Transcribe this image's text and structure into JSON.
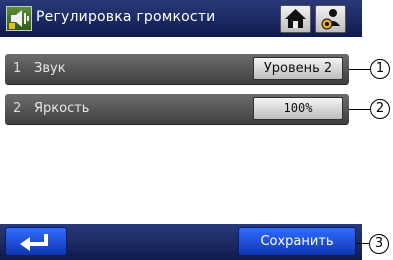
{
  "header": {
    "title": "Регулировка громкости",
    "icon": "speaker-icon"
  },
  "rows": [
    {
      "number": "1",
      "label": "Звук",
      "value": "Уровень 2"
    },
    {
      "number": "2",
      "label": "Яркость",
      "value": "100%"
    }
  ],
  "footer": {
    "back_icon": "return-arrow-icon",
    "save_label": "Сохранить"
  },
  "callouts": [
    "1",
    "2",
    "3"
  ],
  "colors": {
    "header_bg": "#1b2a66",
    "row_bg": "#555555",
    "button_blue": "#1f52d6"
  }
}
